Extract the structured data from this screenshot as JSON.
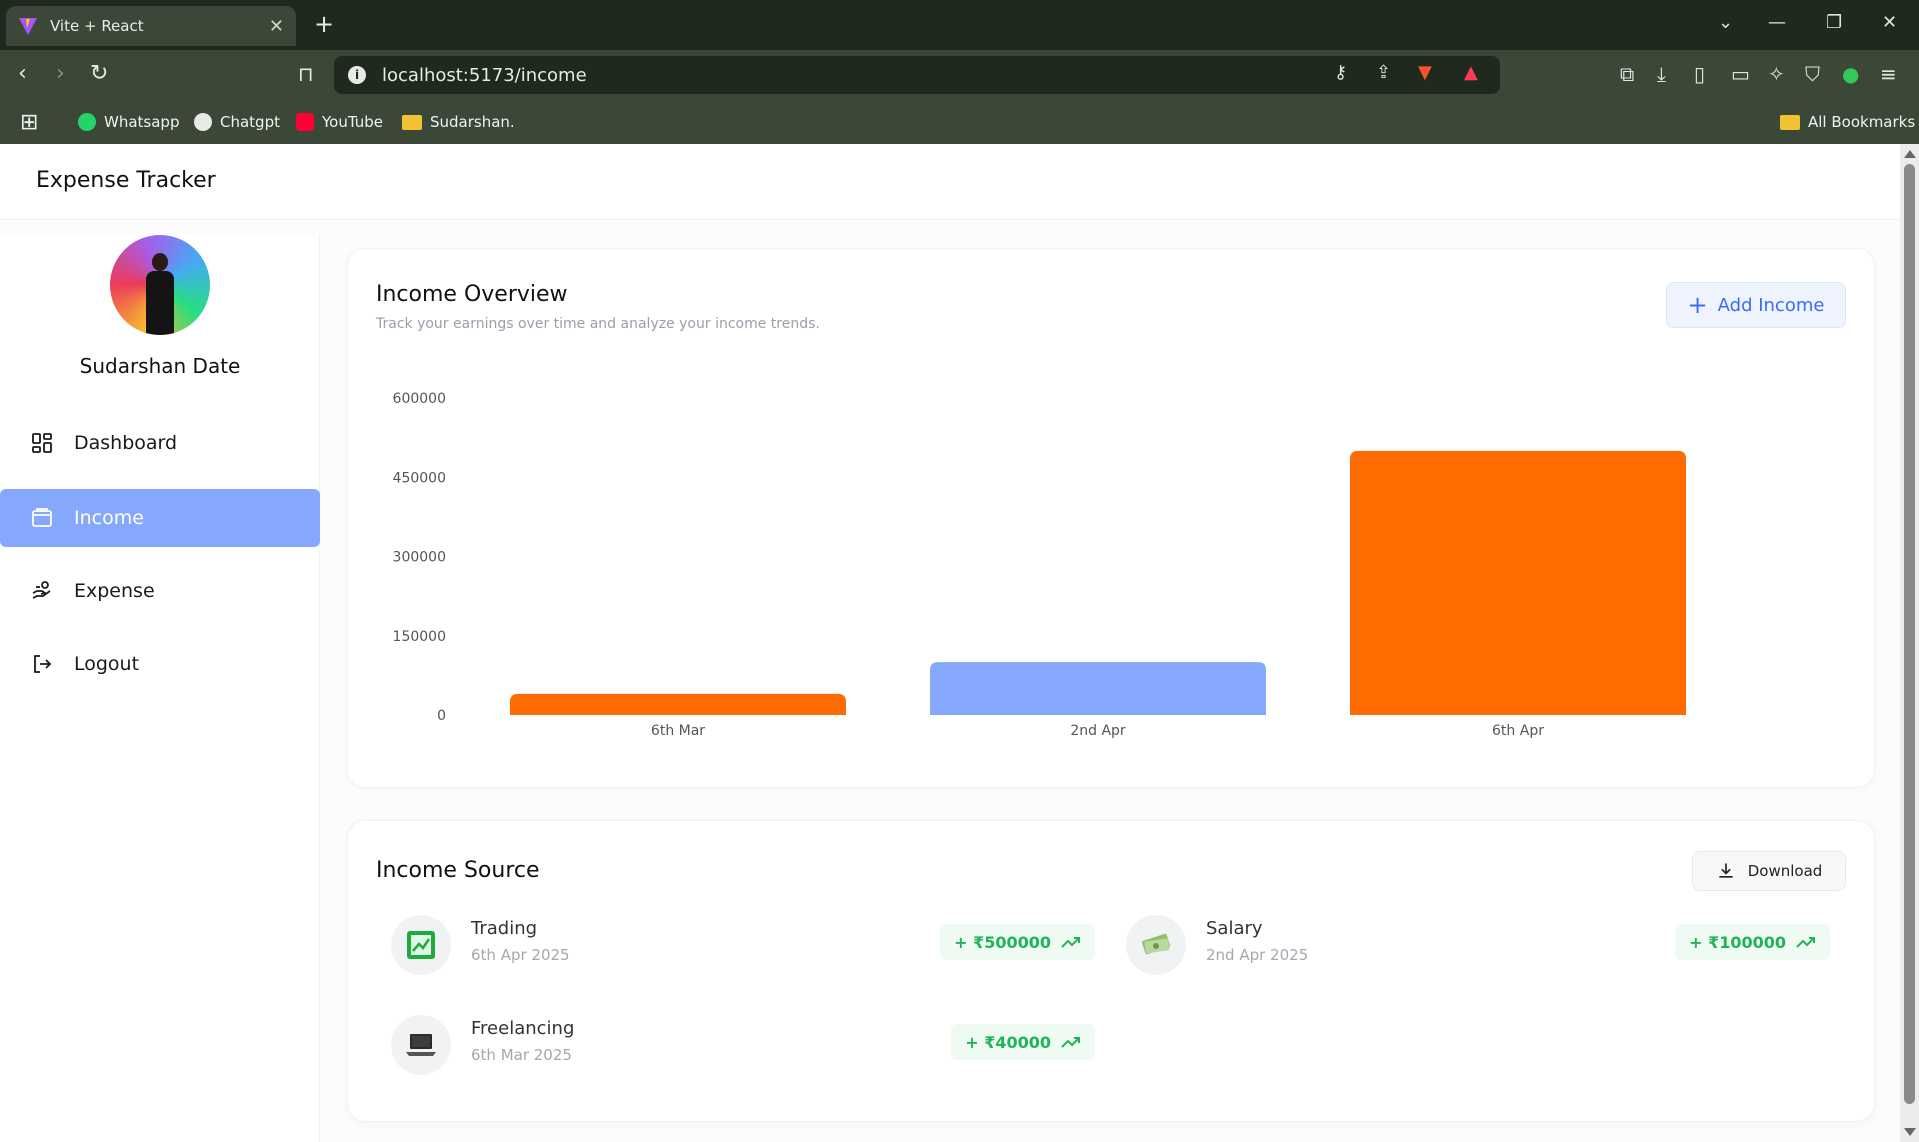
{
  "browser": {
    "tab_title": "Vite + React",
    "url": "localhost:5173/income",
    "bookmarks": [
      "Whatsapp",
      "Chatgpt",
      "YouTube",
      "Sudarshan."
    ],
    "all_bookmarks": "All Bookmarks"
  },
  "app": {
    "title": "Expense Tracker"
  },
  "sidebar": {
    "user_name": "Sudarshan Date",
    "items": [
      {
        "label": "Dashboard",
        "icon": "dashboard-grid-icon"
      },
      {
        "label": "Income",
        "icon": "wallet-icon",
        "active": true
      },
      {
        "label": "Expense",
        "icon": "hand-coins-icon"
      },
      {
        "label": "Logout",
        "icon": "logout-icon"
      }
    ]
  },
  "overview": {
    "title": "Income Overview",
    "subtitle": "Track your earnings over time and analyze your income trends.",
    "add_button": "Add Income"
  },
  "chart_data": {
    "type": "bar",
    "categories": [
      "6th Mar",
      "2nd Apr",
      "6th Apr"
    ],
    "values": [
      40000,
      100000,
      500000
    ],
    "colors": [
      "#ff6b00",
      "#86a8fc",
      "#ff6b00"
    ],
    "y_ticks": [
      "600000",
      "450000",
      "300000",
      "150000",
      "0"
    ],
    "ylim": [
      0,
      600000
    ],
    "grid": false,
    "legend": "none"
  },
  "sources": {
    "title": "Income Source",
    "download_button": "Download",
    "items": [
      {
        "name": "Trading",
        "date": "6th Apr 2025",
        "amount": "+ ₹500000",
        "icon": "trading-chart-icon"
      },
      {
        "name": "Salary",
        "date": "2nd Apr 2025",
        "amount": "+ ₹100000",
        "icon": "money-icon"
      },
      {
        "name": "Freelancing",
        "date": "6th Mar 2025",
        "amount": "+ ₹40000",
        "icon": "laptop-icon"
      }
    ]
  }
}
